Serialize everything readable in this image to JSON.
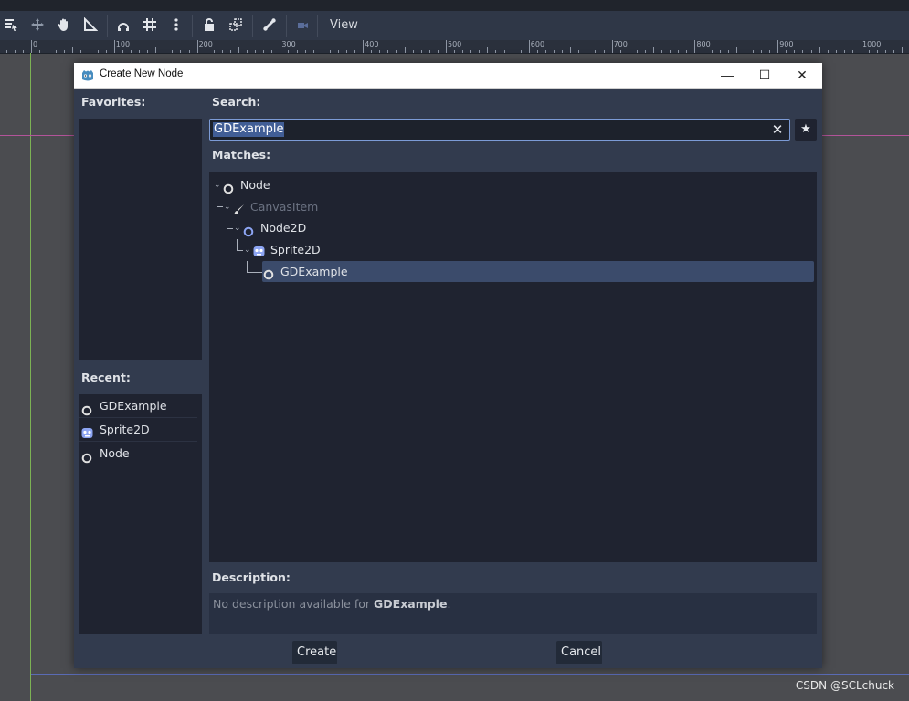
{
  "editor": {
    "view_menu": "View",
    "ruler_labels": [
      "0",
      "100",
      "200",
      "300",
      "400",
      "500",
      "600",
      "700",
      "800",
      "900",
      "1000"
    ],
    "toolbar_icons": [
      "select-list-icon",
      "move-icon",
      "pan-hand-icon",
      "ruler-icon",
      "smart-snap-icon",
      "grid-snap-icon",
      "more-options-icon",
      "lock-icon",
      "group-icon",
      "bone-icon",
      "camera-override-icon"
    ]
  },
  "dialog": {
    "title": "Create New Node",
    "window_controls": {
      "minimize": "—",
      "maximize": "☐",
      "close": "✕"
    },
    "favorites_label": "Favorites:",
    "search_label": "Search:",
    "search_value": "GDExample",
    "clear_glyph": "✕",
    "favorite_glyph": "★",
    "matches_label": "Matches:",
    "tree": [
      {
        "label": "Node",
        "icon": "node-circle-icon",
        "depth": 0,
        "dim": false,
        "selected": false
      },
      {
        "label": "CanvasItem",
        "icon": "brush-icon",
        "depth": 1,
        "dim": true,
        "selected": false
      },
      {
        "label": "Node2D",
        "icon": "node2d-circle-icon",
        "depth": 2,
        "dim": false,
        "selected": false
      },
      {
        "label": "Sprite2D",
        "icon": "sprite2d-icon",
        "depth": 3,
        "dim": false,
        "selected": false
      },
      {
        "label": "GDExample",
        "icon": "node-circle-icon",
        "depth": 4,
        "dim": false,
        "selected": true
      }
    ],
    "recent_label": "Recent:",
    "recent": [
      {
        "label": "GDExample",
        "icon": "node-circle-icon"
      },
      {
        "label": "Sprite2D",
        "icon": "sprite2d-icon"
      },
      {
        "label": "Node",
        "icon": "node-circle-icon"
      }
    ],
    "description_label": "Description:",
    "description_prefix": "No description available for ",
    "description_name": "GDExample",
    "description_suffix": ".",
    "create_label": "Create",
    "cancel_label": "Cancel"
  },
  "watermark": "CSDN @SCLchuck",
  "colors": {
    "accent": "#7c9bd6",
    "selection": "#3b4b6b",
    "node2d_blue": "#8da5f3",
    "panel": "#1f2330"
  }
}
